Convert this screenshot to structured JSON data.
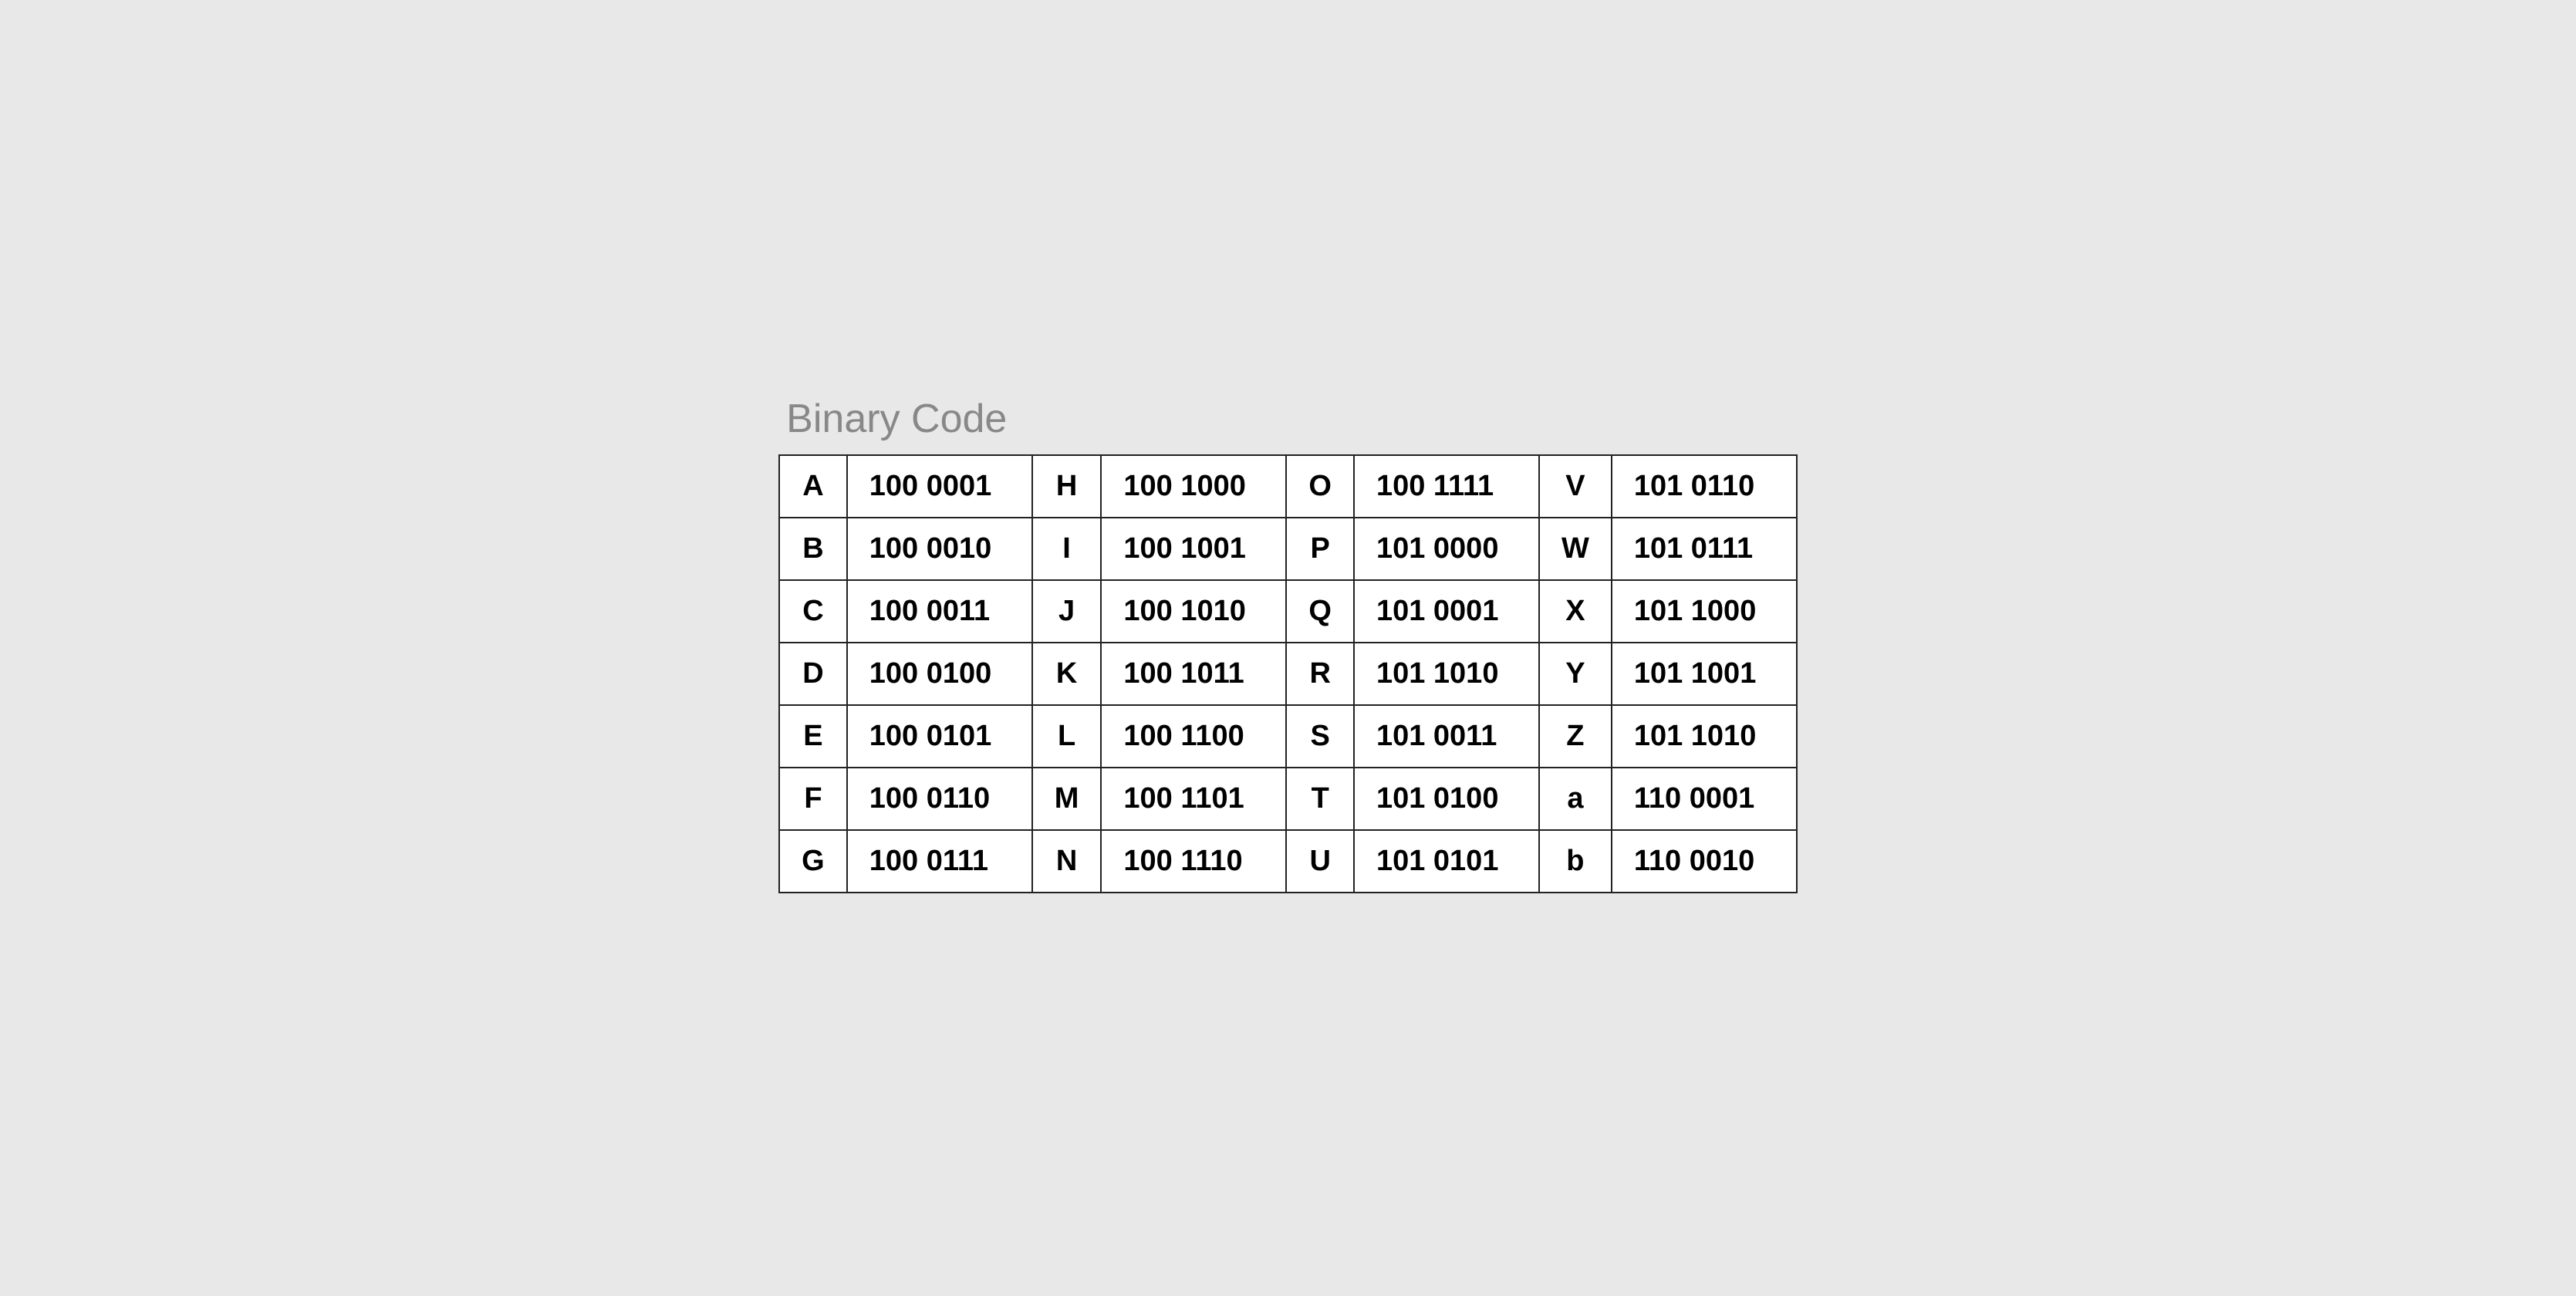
{
  "title": "Binary Code",
  "rows": [
    [
      {
        "letter": "A",
        "code": "100 0001"
      },
      {
        "letter": "H",
        "code": "100 1000"
      },
      {
        "letter": "O",
        "code": "100 1111"
      },
      {
        "letter": "V",
        "code": "101 0110"
      }
    ],
    [
      {
        "letter": "B",
        "code": "100 0010"
      },
      {
        "letter": "I",
        "code": "100 1001"
      },
      {
        "letter": "P",
        "code": "101 0000"
      },
      {
        "letter": "W",
        "code": "101 0111"
      }
    ],
    [
      {
        "letter": "C",
        "code": "100 0011"
      },
      {
        "letter": "J",
        "code": "100 1010"
      },
      {
        "letter": "Q",
        "code": "101 0001"
      },
      {
        "letter": "X",
        "code": "101 1000"
      }
    ],
    [
      {
        "letter": "D",
        "code": "100 0100"
      },
      {
        "letter": "K",
        "code": "100 1011"
      },
      {
        "letter": "R",
        "code": "101 1010"
      },
      {
        "letter": "Y",
        "code": "101 1001"
      }
    ],
    [
      {
        "letter": "E",
        "code": "100 0101"
      },
      {
        "letter": "L",
        "code": "100 1100"
      },
      {
        "letter": "S",
        "code": "101 0011"
      },
      {
        "letter": "Z",
        "code": "101 1010"
      }
    ],
    [
      {
        "letter": "F",
        "code": "100 0110"
      },
      {
        "letter": "M",
        "code": "100 1101"
      },
      {
        "letter": "T",
        "code": "101 0100"
      },
      {
        "letter": "a",
        "code": "110 0001"
      }
    ],
    [
      {
        "letter": "G",
        "code": "100 0111"
      },
      {
        "letter": "N",
        "code": "100 1110"
      },
      {
        "letter": "U",
        "code": "101 0101"
      },
      {
        "letter": "b",
        "code": "110 0010"
      }
    ]
  ]
}
